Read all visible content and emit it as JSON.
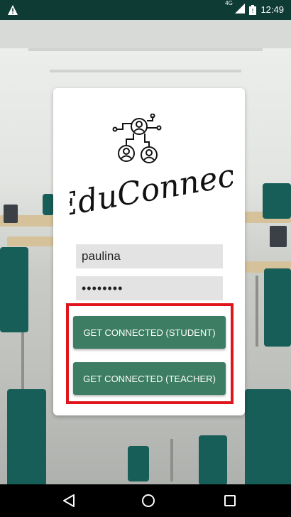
{
  "status_bar": {
    "network": "4G",
    "time": "12:49",
    "icons": [
      "alert-icon",
      "signal-icon",
      "battery-icon"
    ]
  },
  "app": {
    "name": "EduConnect"
  },
  "login": {
    "username": "paulina",
    "password_masked": "••••••••",
    "student_button": "GET CONNECTED (STUDENT)",
    "teacher_button": "GET CONNECTED (TEACHER)"
  },
  "nav_bar": {
    "icons": [
      "back-icon",
      "home-icon",
      "recent-apps-icon"
    ]
  },
  "colors": {
    "status_bar": "#0f3b35",
    "button": "#3d7d63",
    "highlight": "#e0141b",
    "field": "#e3e3e3"
  }
}
